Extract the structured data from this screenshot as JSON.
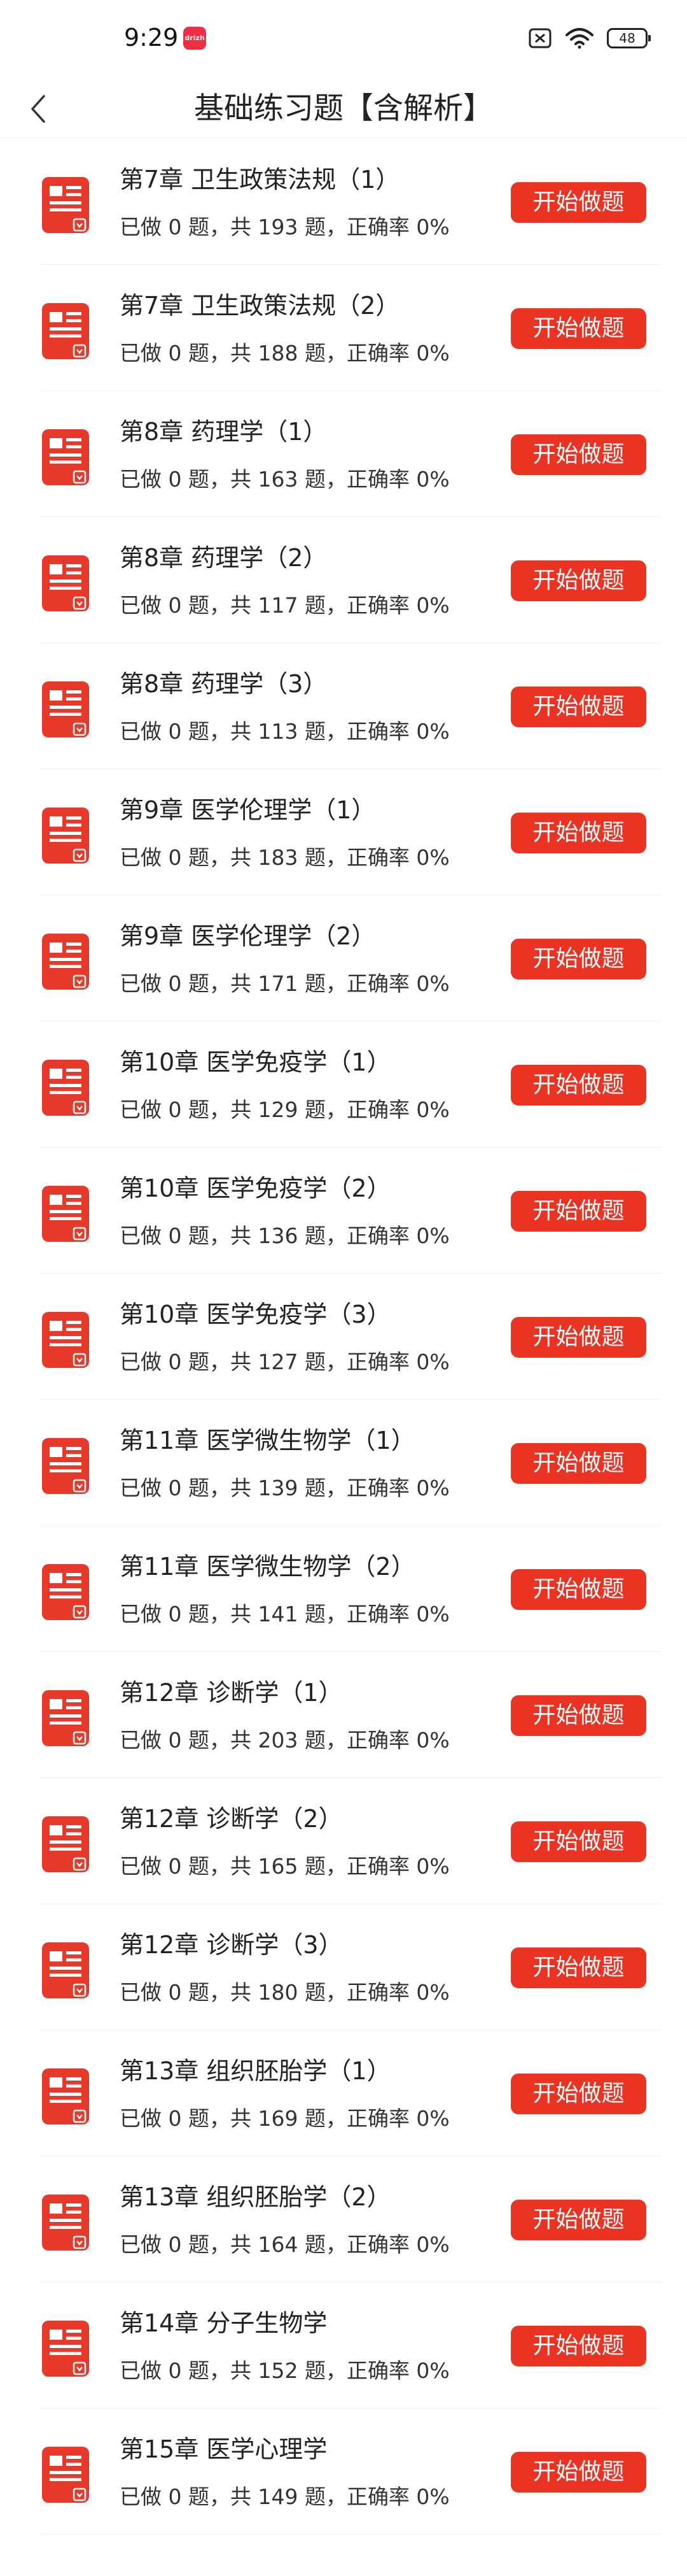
{
  "status_bar": {
    "time": "9:29",
    "app_badge": "drizh",
    "battery": "48"
  },
  "header": {
    "title": "基础练习题【含解析】"
  },
  "colors": {
    "accent": "#ea3323",
    "icon_red": "#e6392a"
  },
  "list": {
    "button_label": "开始做题",
    "items": [
      {
        "title": "第7章  卫生政策法规（1）",
        "stats": "已做 0 题，共 193 题，正确率 0%"
      },
      {
        "title": "第7章  卫生政策法规（2）",
        "stats": "已做 0 题，共 188 题，正确率 0%"
      },
      {
        "title": "第8章  药理学（1）",
        "stats": "已做 0 题，共 163 题，正确率 0%"
      },
      {
        "title": "第8章  药理学（2）",
        "stats": "已做 0 题，共 117 题，正确率 0%"
      },
      {
        "title": "第8章  药理学（3）",
        "stats": "已做 0 题，共 113 题，正确率 0%"
      },
      {
        "title": "第9章  医学伦理学（1）",
        "stats": "已做 0 题，共 183 题，正确率 0%"
      },
      {
        "title": "第9章  医学伦理学（2）",
        "stats": "已做 0 题，共 171 题，正确率 0%"
      },
      {
        "title": "第10章  医学免疫学（1）",
        "stats": "已做 0 题，共 129 题，正确率 0%"
      },
      {
        "title": "第10章  医学免疫学（2）",
        "stats": "已做 0 题，共 136 题，正确率 0%"
      },
      {
        "title": "第10章  医学免疫学（3）",
        "stats": "已做 0 题，共 127 题，正确率 0%"
      },
      {
        "title": "第11章  医学微生物学（1）",
        "stats": "已做 0 题，共 139 题，正确率 0%"
      },
      {
        "title": "第11章  医学微生物学（2）",
        "stats": "已做 0 题，共 141 题，正确率 0%"
      },
      {
        "title": "第12章  诊断学（1）",
        "stats": "已做 0 题，共 203 题，正确率 0%"
      },
      {
        "title": "第12章  诊断学（2）",
        "stats": "已做 0 题，共 165 题，正确率 0%"
      },
      {
        "title": "第12章  诊断学（3）",
        "stats": "已做 0 题，共 180 题，正确率 0%"
      },
      {
        "title": "第13章  组织胚胎学（1）",
        "stats": "已做 0 题，共 169 题，正确率 0%"
      },
      {
        "title": "第13章  组织胚胎学（2）",
        "stats": "已做 0 题，共 164 题，正确率 0%"
      },
      {
        "title": "第14章  分子生物学",
        "stats": "已做 0 题，共 152 题，正确率 0%"
      },
      {
        "title": "第15章  医学心理学",
        "stats": "已做 0 题，共 149 题，正确率 0%"
      }
    ]
  }
}
